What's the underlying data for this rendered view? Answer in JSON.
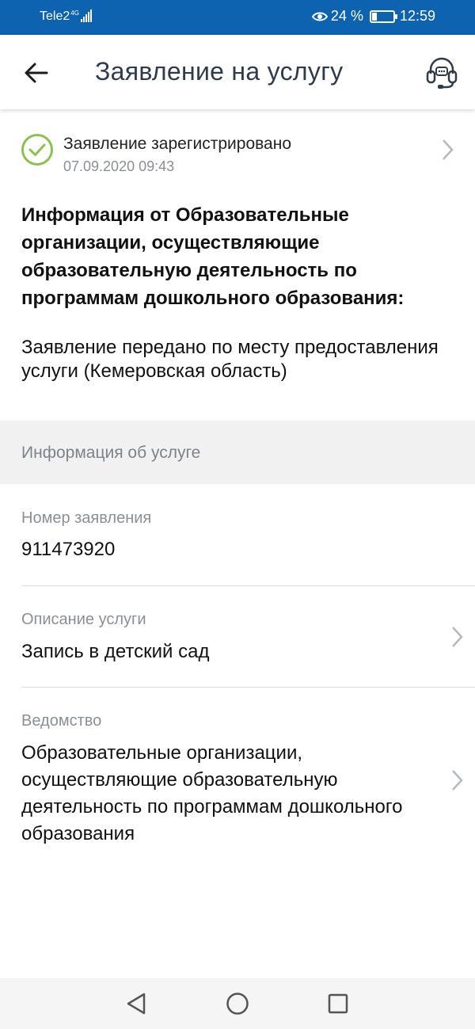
{
  "status_bar": {
    "carrier": "Tele2",
    "network": "4G",
    "battery_percent": "24 %",
    "battery_level": 0.24,
    "time": "12:59"
  },
  "app_bar": {
    "title": "Заявление на услугу",
    "back_icon": "arrow-left-icon",
    "support_icon": "headset-icon"
  },
  "status": {
    "text": "Заявление зарегистрировано",
    "date": "07.09.2020 09:43",
    "icon": "check-circle-icon",
    "icon_color": "#8cc152"
  },
  "info": {
    "title": "Информация от Образовательные организации, осуществляющие образовательную деятельность по программам дошкольного образования:",
    "body": "Заявление передано по месту предоставления услуги (Кемеровская область)"
  },
  "service_section": {
    "header": "Информация об услуге",
    "fields": [
      {
        "label": "Номер заявления",
        "value": "911473920"
      },
      {
        "label": "Описание услуги",
        "value": "Запись в детский сад"
      },
      {
        "label": "Ведомство",
        "value": "Образовательные организации, осуществляющие образовательную деятельность по программам дошкольного образования"
      }
    ]
  },
  "colors": {
    "status_bar": "#0d63b0",
    "title_text": "#2f3a4a",
    "secondary_text": "#8a8f96",
    "section_bg": "#f1f1f1"
  }
}
